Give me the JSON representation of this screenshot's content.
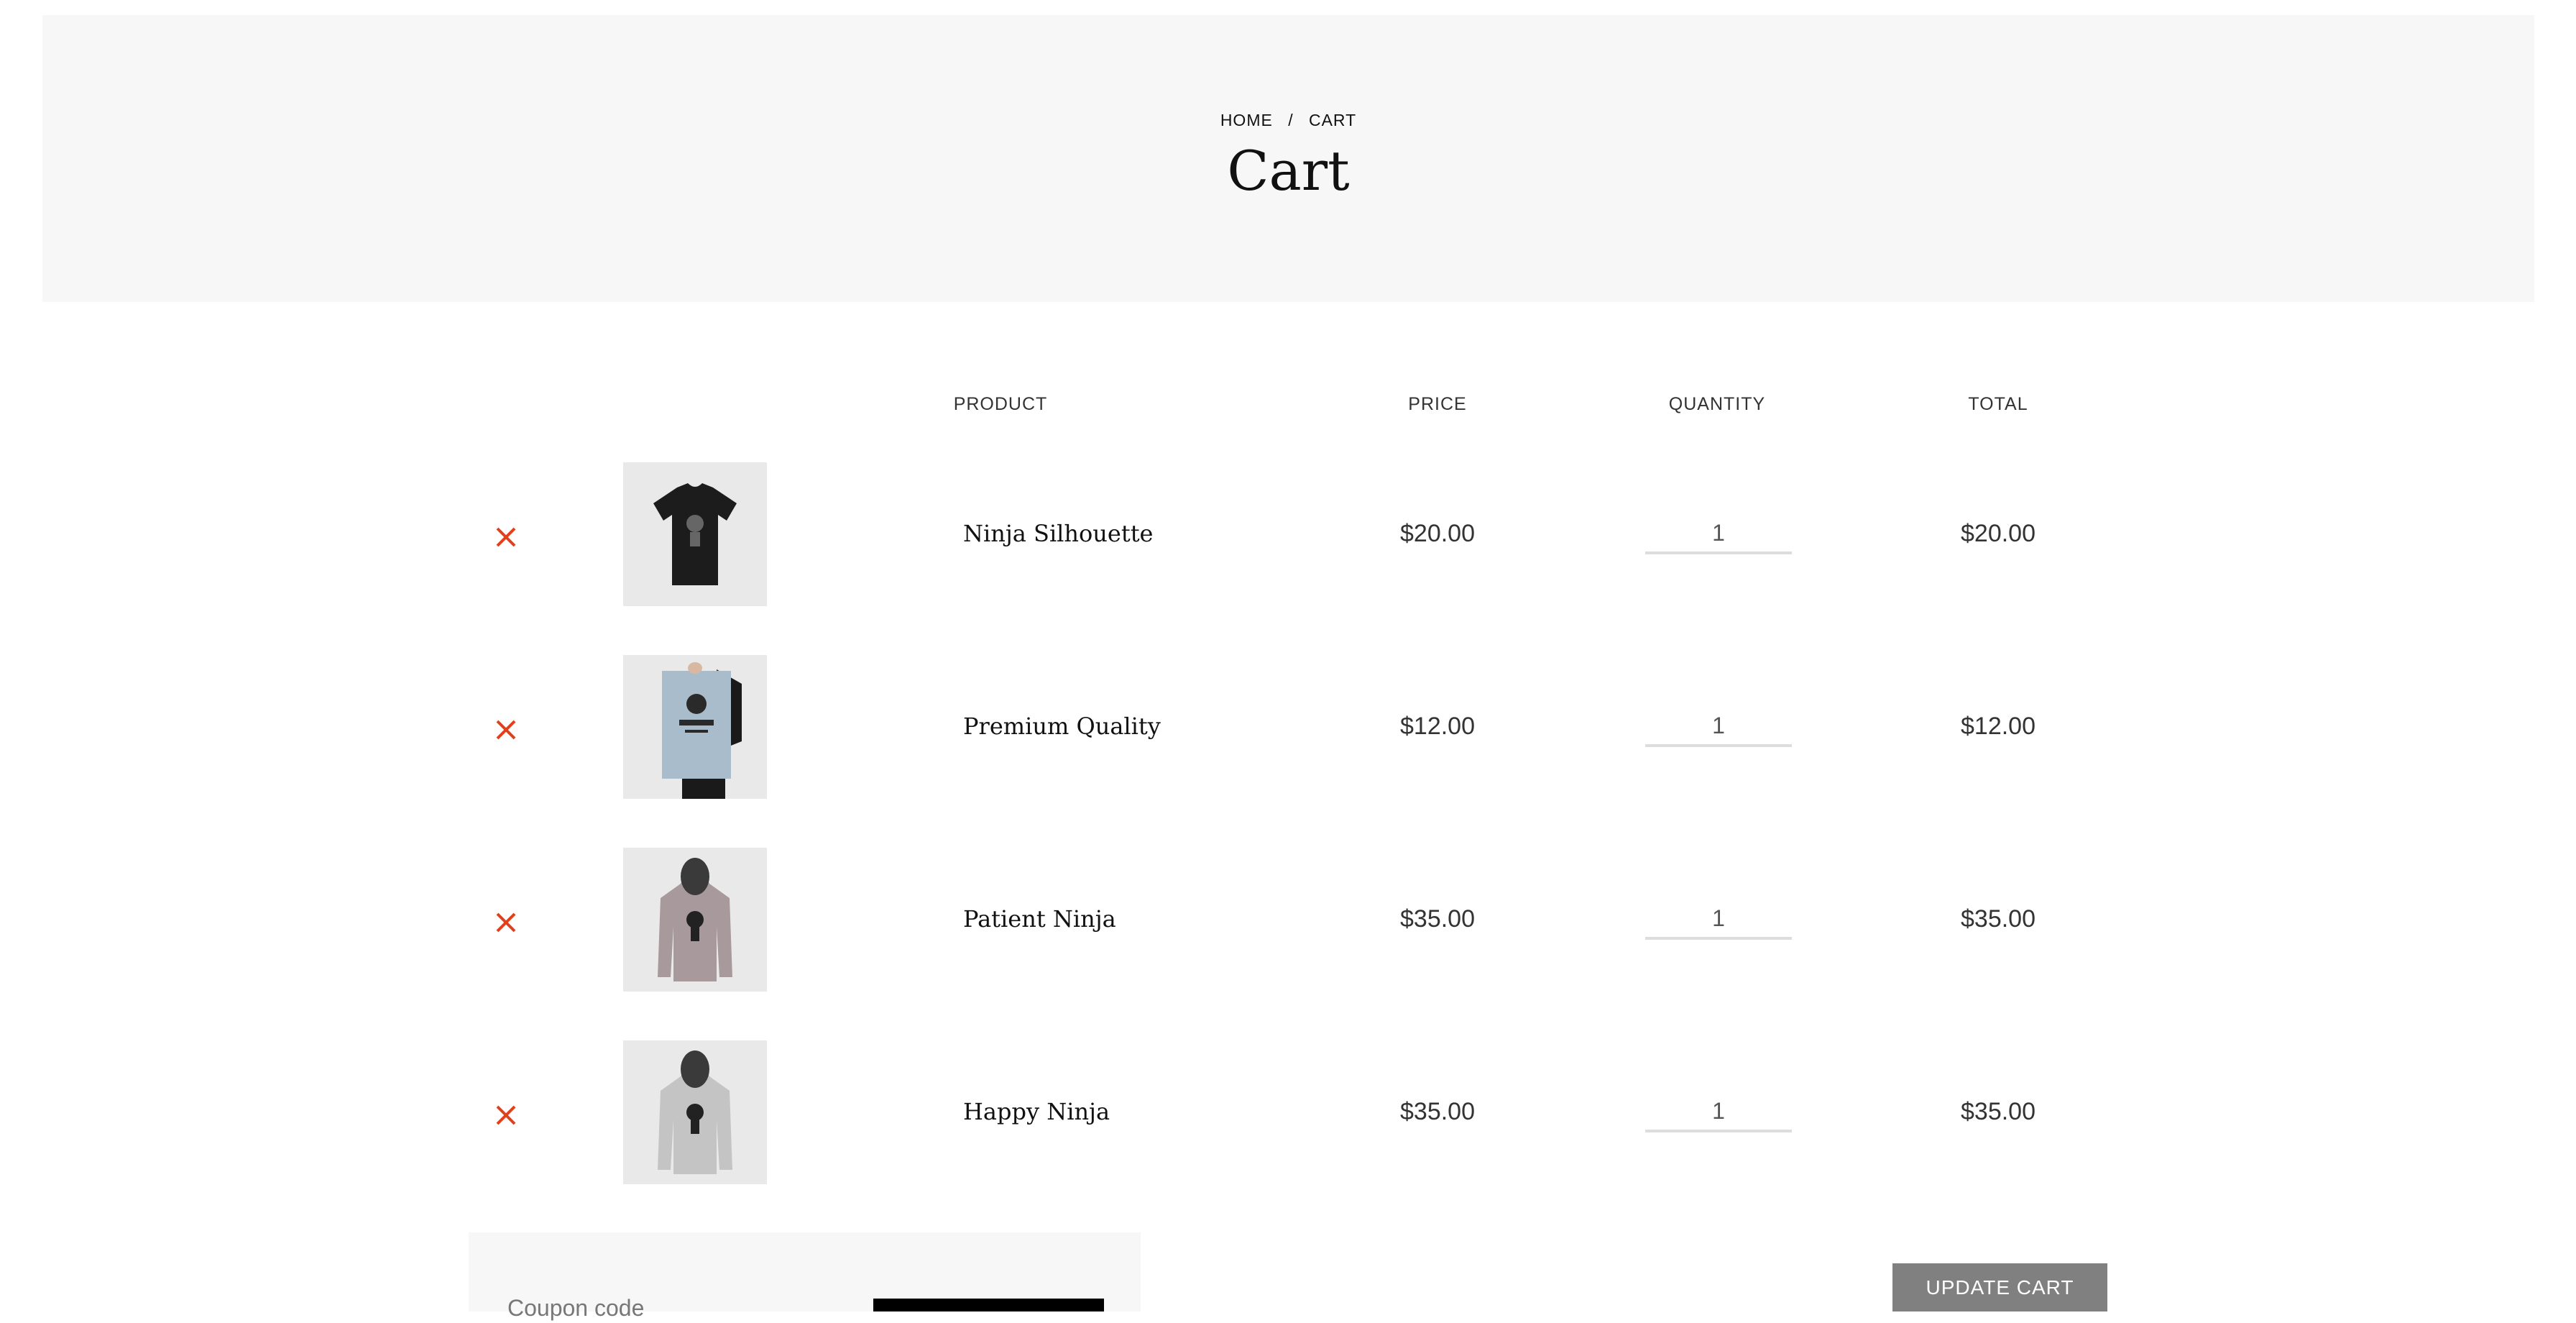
{
  "breadcrumb": {
    "home": "HOME",
    "separator": "/",
    "current": "CART"
  },
  "page_title": "Cart",
  "table": {
    "headers": {
      "product": "PRODUCT",
      "price": "PRICE",
      "quantity": "QUANTITY",
      "total": "TOTAL"
    },
    "rows": [
      {
        "name": "Ninja Silhouette",
        "price": "$20.00",
        "quantity": "1",
        "total": "$20.00",
        "image": "tshirt-black"
      },
      {
        "name": "Premium Quality",
        "price": "$12.00",
        "quantity": "1",
        "total": "$12.00",
        "image": "poster"
      },
      {
        "name": "Patient Ninja",
        "price": "$35.00",
        "quantity": "1",
        "total": "$35.00",
        "image": "hoodie-mauve"
      },
      {
        "name": "Happy Ninja",
        "price": "$35.00",
        "quantity": "1",
        "total": "$35.00",
        "image": "hoodie-grey"
      }
    ]
  },
  "coupon": {
    "placeholder": "Coupon code",
    "apply_label": ""
  },
  "update_cart_label": "UPDATE CART",
  "colors": {
    "remove": "#e2401c",
    "hero_bg": "#f7f7f7",
    "update_button": "#808080"
  },
  "icons": {
    "remove": "close-icon"
  }
}
